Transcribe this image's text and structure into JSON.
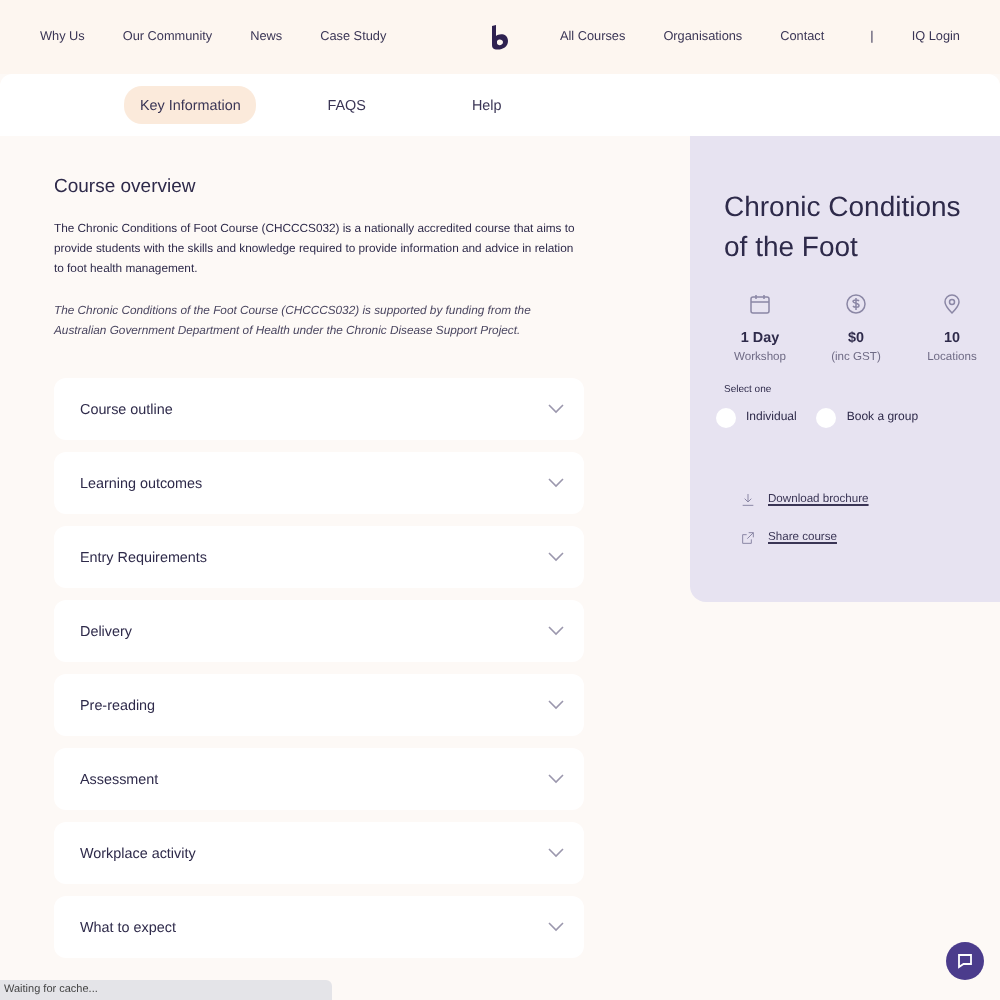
{
  "nav_left": [
    "Why Us",
    "Our Community",
    "News",
    "Case Study"
  ],
  "nav_right": [
    "All Courses",
    "Organisations",
    "Contact"
  ],
  "separator": "|",
  "login": "IQ Login",
  "tabs": [
    {
      "label": "Key Information",
      "selected": true
    },
    {
      "label": "FAQS",
      "selected": false
    },
    {
      "label": "Help",
      "selected": false
    }
  ],
  "overview": {
    "heading": "Course overview",
    "paragraph": "The Chronic Conditions of Foot Course (CHCCCS032) is a nationally accredited course that aims to provide students with the skills and knowledge required to provide information and advice in relation to foot health management.",
    "note": "The Chronic Conditions of the Foot Course (CHCCCS032) is supported by funding from the Australian Government Department of Health under the Chronic Disease Support Project."
  },
  "accordion": [
    {
      "title": "Course outline",
      "expanded": false
    },
    {
      "title": "Learning outcomes",
      "expanded": false
    },
    {
      "title": "Entry Requirements",
      "expanded": false
    },
    {
      "title": "Delivery",
      "expanded": false
    },
    {
      "title": "Pre-reading",
      "expanded": false
    },
    {
      "title": "Assessment",
      "expanded": false
    },
    {
      "title": "Workplace activity",
      "expanded": false
    },
    {
      "title": "What to expect",
      "expanded": false
    }
  ],
  "card": {
    "title": "Chronic Conditions of the Foot",
    "stats": [
      {
        "kind": "calendar",
        "value": "1 Day",
        "label": "Workshop"
      },
      {
        "kind": "dollar",
        "value": "$0",
        "label": "(inc GST)"
      },
      {
        "kind": "pin",
        "value": "10",
        "label": "Locations"
      }
    ],
    "select_label": "Select one",
    "options": [
      {
        "label": "Individual",
        "selected": false
      },
      {
        "label": "Book a group",
        "selected": false
      }
    ],
    "links": [
      {
        "kind": "download",
        "label": "Download brochure"
      },
      {
        "kind": "share",
        "label": "Share course"
      }
    ]
  },
  "status_bar": "Waiting for cache..."
}
